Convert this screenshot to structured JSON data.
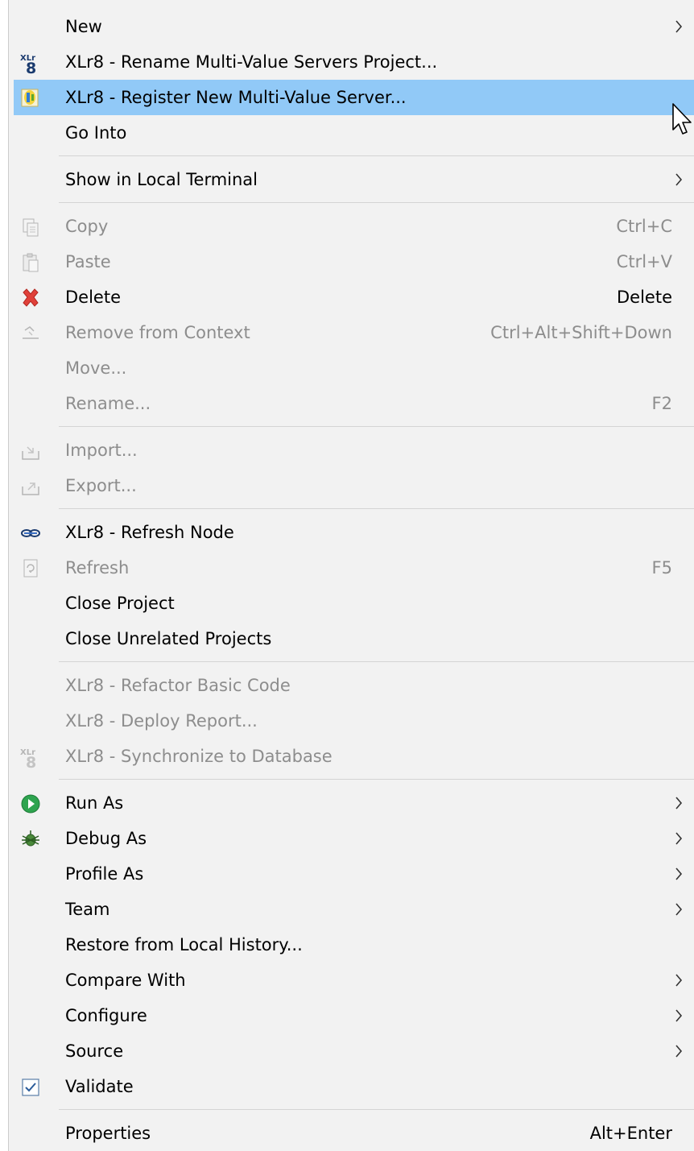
{
  "menu": {
    "items": [
      {
        "label": "New"
      },
      {
        "label": "XLr8 - Rename Multi-Value Servers Project..."
      },
      {
        "label": "XLr8 - Register New Multi-Value Server..."
      },
      {
        "label": "Go Into"
      },
      {
        "label": "Show in Local Terminal"
      },
      {
        "label": "Copy",
        "shortcut": "Ctrl+C"
      },
      {
        "label": "Paste",
        "shortcut": "Ctrl+V"
      },
      {
        "label": "Delete",
        "shortcut": "Delete"
      },
      {
        "label": "Remove from Context",
        "shortcut": "Ctrl+Alt+Shift+Down"
      },
      {
        "label": "Move..."
      },
      {
        "label": "Rename...",
        "shortcut": "F2"
      },
      {
        "label": "Import..."
      },
      {
        "label": "Export..."
      },
      {
        "label": "XLr8 - Refresh Node"
      },
      {
        "label": "Refresh",
        "shortcut": "F5"
      },
      {
        "label": "Close Project"
      },
      {
        "label": "Close Unrelated Projects"
      },
      {
        "label": "XLr8 - Refactor Basic Code"
      },
      {
        "label": "XLr8 - Deploy Report..."
      },
      {
        "label": "XLr8 - Synchronize to Database"
      },
      {
        "label": "Run As"
      },
      {
        "label": "Debug As"
      },
      {
        "label": "Profile As"
      },
      {
        "label": "Team"
      },
      {
        "label": "Restore from Local History..."
      },
      {
        "label": "Compare With"
      },
      {
        "label": "Configure"
      },
      {
        "label": "Source"
      },
      {
        "label": "Validate"
      },
      {
        "label": "Properties",
        "shortcut": "Alt+Enter"
      }
    ]
  },
  "icons": {
    "xlr8_logo_text": "XLr"
  },
  "colors": {
    "highlight": "#91c9f7",
    "disabled_text": "#8d8d8d",
    "delete_icon": "#e0413a",
    "run_icon": "#2ea44f"
  }
}
